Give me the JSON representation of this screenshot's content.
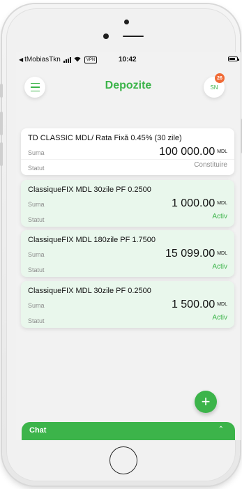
{
  "status_bar": {
    "carrier": "tMobiasTkn",
    "vpn_label": "VPN",
    "time": "10:42"
  },
  "header": {
    "title": "Depozite",
    "avatar_initials": "SN",
    "notification_count": "26"
  },
  "deposits": [
    {
      "title": "TD CLASSIC MDL/ Rata Fixă 0.45% (30 zile)",
      "amount_label": "Suma",
      "amount": "100 000.00",
      "currency": "MDL",
      "status_label": "Statut",
      "status": "Constituire",
      "status_color": "#8c8c8c"
    },
    {
      "title": "ClassiqueFIX MDL 30zile PF 0.2500",
      "amount_label": "Suma",
      "amount": "1 000.00",
      "currency": "MDL",
      "status_label": "Statut",
      "status": "Activ",
      "status_color": "#3cb44a"
    },
    {
      "title": "ClassiqueFIX MDL 180zile PF 1.7500",
      "amount_label": "Suma",
      "amount": "15 099.00",
      "currency": "MDL",
      "status_label": "Statut",
      "status": "Activ",
      "status_color": "#3cb44a"
    },
    {
      "title": "ClassiqueFIX MDL 30zile PF 0.2500",
      "amount_label": "Suma",
      "amount": "1 500.00",
      "currency": "MDL",
      "status_label": "Statut",
      "status": "Activ",
      "status_color": "#3cb44a"
    }
  ],
  "fab": {
    "icon": "plus-icon",
    "symbol": "+"
  },
  "chat": {
    "label": "Chat",
    "icon": "chevron-up-icon"
  },
  "colors": {
    "accent": "#3cb44a",
    "badge": "#f06a35",
    "active_card_bg": "#e9f7ec"
  }
}
